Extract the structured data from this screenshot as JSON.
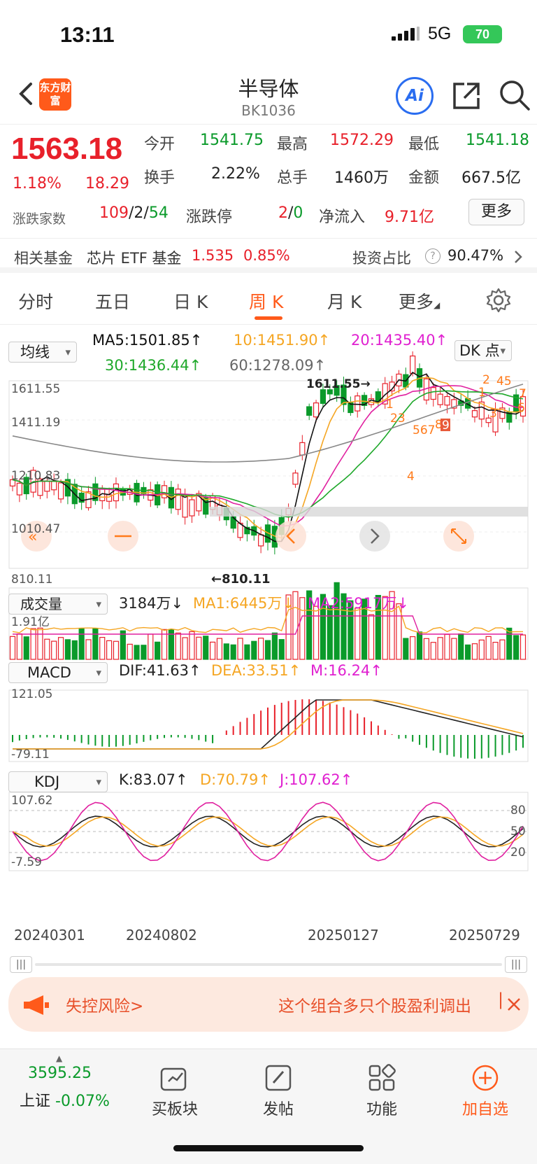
{
  "status": {
    "time": "13:11",
    "network": "5G",
    "battery": "70"
  },
  "header": {
    "title": "半导体",
    "code": "BK1036",
    "logo_text": "东方财富",
    "ai_label": "Ai"
  },
  "quote": {
    "price": "1563.18",
    "change_pct": "1.18%",
    "change": "18.29",
    "open_label": "今开",
    "open": "1541.75",
    "high_label": "最高",
    "high": "1572.29",
    "low_label": "最低",
    "low": "1541.18",
    "turnover_label": "换手",
    "turnover": "2.22%",
    "volume_label": "总手",
    "volume": "1460万",
    "amount_label": "金额",
    "amount": "667.5亿",
    "breadth_label": "涨跌家数",
    "breadth_up": "109",
    "breadth_flat": "2",
    "breadth_down": "54",
    "limit_label": "涨跌停",
    "limit_up": "2",
    "limit_down": "0",
    "inflow_label": "净流入",
    "inflow": "9.71亿",
    "more_label": "更多"
  },
  "fund": {
    "label": "相关基金",
    "name": "芯片 ETF 基金",
    "price": "1.535",
    "pct": "0.85%",
    "ratio_label": "投资占比",
    "ratio": "90.47%"
  },
  "tabs": [
    "分时",
    "五日",
    "日 K",
    "周 K",
    "月 K",
    "更多"
  ],
  "kline": {
    "ma_selector": "均线",
    "ma5": "MA5:1501.85",
    "ma10": "10:1451.90",
    "ma20": "20:1435.40",
    "ma30": "30:1436.44",
    "ma60": "60:1278.09",
    "dk_label": "DK 点",
    "y_labels": [
      "1611.55",
      "1411.19",
      "1210.83",
      "1010.47",
      "810.11"
    ],
    "max_marker": "1611.55",
    "min_marker": "810.11"
  },
  "volume": {
    "selector": "成交量",
    "value": "3184万",
    "ma1": "MA1:6445万",
    "ma2": "MA2:5917万",
    "y_label": "1.91亿"
  },
  "macd": {
    "selector": "MACD",
    "dif": "DIF:41.63",
    "dea": "DEA:33.51",
    "m": "M:16.24",
    "y_top": "121.05",
    "y_bottom": "-79.11"
  },
  "kdj": {
    "selector": "KDJ",
    "k": "K:83.07",
    "d": "D:70.79",
    "j": "J:107.62",
    "y_top": "107.62",
    "y_bottom": "-7.59",
    "levels": [
      "80",
      "50",
      "20"
    ]
  },
  "dates": [
    "20240301",
    "20240802",
    "20250127",
    "20250729"
  ],
  "banner": {
    "left": "失控风险>",
    "right": "这个组合多只个股盈利调出"
  },
  "bottom": {
    "index_value": "3595.25",
    "index_name": "上证",
    "index_pct": "-0.07%",
    "board": "买板块",
    "post": "发帖",
    "func": "功能",
    "watch": "加自选"
  },
  "colors": {
    "up": "#e8202a",
    "down": "#0a9a2a",
    "ma5": "#111111",
    "ma10": "#f5a623",
    "ma20": "#e020a0",
    "ma30": "#1ea82a",
    "ma60": "#888888",
    "accent": "#ff5a1a"
  }
}
